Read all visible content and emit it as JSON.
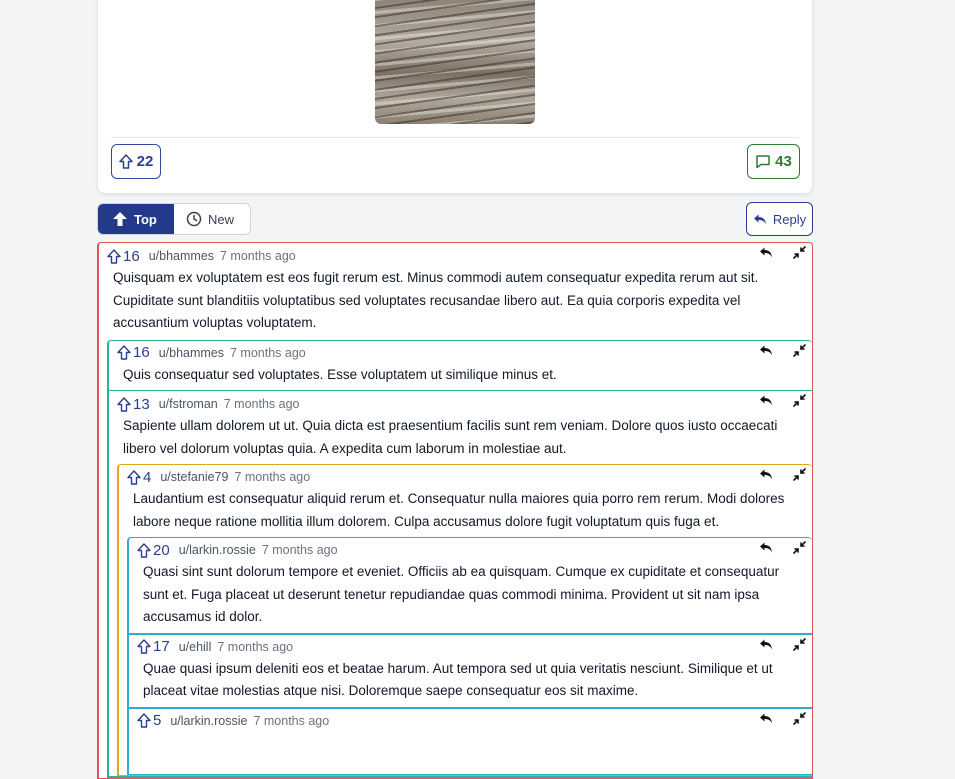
{
  "post": {
    "votes": "22",
    "comments": "43"
  },
  "sort": {
    "top_label": "Top",
    "new_label": "New"
  },
  "reply_label": "Reply",
  "colors": {
    "depth0": "#e05656",
    "depth1": "#2bb597",
    "depth2": "#e5a21b",
    "depth3": "#33a9d8",
    "brand": "#233a8a"
  },
  "comments": [
    {
      "votes": "16",
      "author": "u/bhammes",
      "time": "7 months ago",
      "text": "Quisquam ex voluptatem est eos fugit rerum est. Minus commodi autem consequatur expedita rerum aut sit. Cupiditate sunt blanditiis voluptatibus sed voluptates recusandae libero aut. Ea quia corporis expedita vel accusantium voluptas voluptatem."
    },
    {
      "votes": "16",
      "author": "u/bhammes",
      "time": "7 months ago",
      "text": "Quis consequatur sed voluptates. Esse voluptatem ut similique minus et."
    },
    {
      "votes": "13",
      "author": "u/fstroman",
      "time": "7 months ago",
      "text": "Sapiente ullam dolorem ut ut. Quia dicta est praesentium facilis sunt rem veniam. Dolore quos iusto occaecati libero vel dolorum voluptas quia. A expedita cum laborum in molestiae aut."
    },
    {
      "votes": "4",
      "author": "u/stefanie79",
      "time": "7 months ago",
      "text": "Laudantium est consequatur aliquid rerum et. Consequatur nulla maiores quia porro rem rerum. Modi dolores labore neque ratione mollitia illum dolorem. Culpa accusamus dolore fugit voluptatum quis fuga et."
    },
    {
      "votes": "20",
      "author": "u/larkin.rossie",
      "time": "7 months ago",
      "text": "Quasi sint sunt dolorum tempore et eveniet. Officiis ab ea quisquam. Cumque ex cupiditate et consequatur sunt et. Fuga placeat ut deserunt tenetur repudiandae quas commodi minima. Provident ut sit nam ipsa accusamus id dolor."
    },
    {
      "votes": "17",
      "author": "u/ehill",
      "time": "7 months ago",
      "text": "Quae quasi ipsum deleniti eos et beatae harum. Aut tempora sed ut quia veritatis nesciunt. Similique et ut placeat vitae molestias atque nisi. Doloremque saepe consequatur eos sit maxime."
    },
    {
      "votes": "5",
      "author": "u/larkin.rossie",
      "time": "7 months ago",
      "text": ""
    }
  ]
}
